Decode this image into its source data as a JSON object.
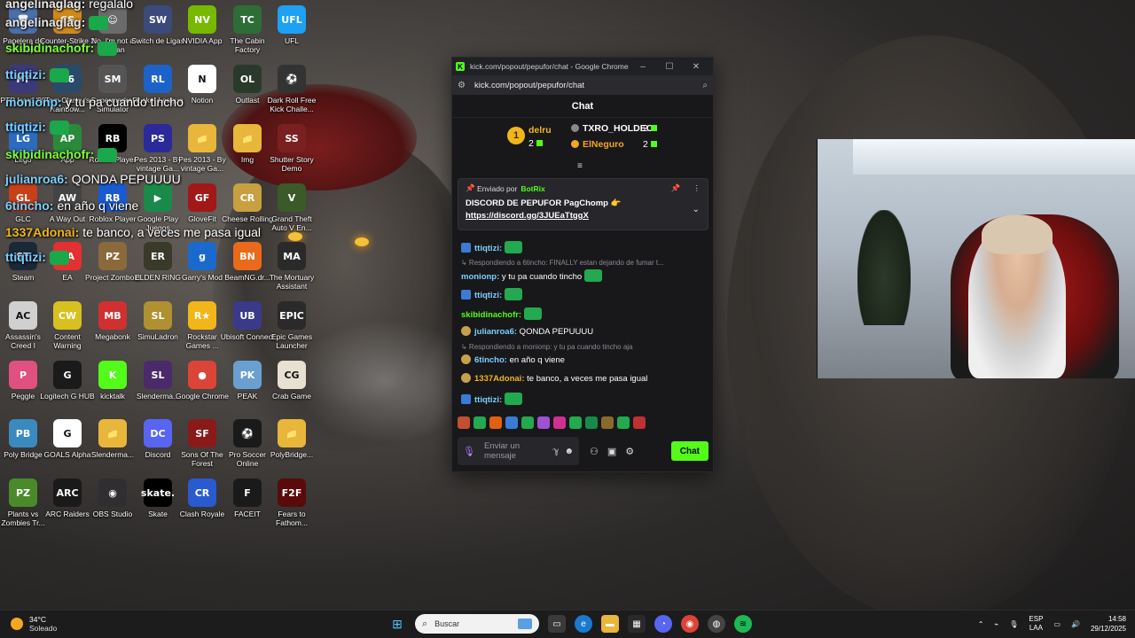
{
  "desktop": {
    "icons": [
      {
        "label": "Papelera de reciclaje",
        "glyph": "🗑",
        "color": "#4b6fa8"
      },
      {
        "label": "Counter-Strike 2",
        "glyph": "CS",
        "color": "#d08a1c"
      },
      {
        "label": "No, I'm not a Human",
        "glyph": "☺",
        "color": "#6b6b6b"
      },
      {
        "label": "Switch de Ligas",
        "glyph": "SW",
        "color": "#3b4a7a"
      },
      {
        "label": "NVIDIA App",
        "glyph": "NV",
        "color": "#76b900"
      },
      {
        "label": "The Cabin Factory",
        "glyph": "TC",
        "color": "#2f6d36"
      },
      {
        "label": "UFL",
        "glyph": "UFL",
        "color": "#1da1f2"
      },
      {
        "label": "PTP Icaro '90",
        "glyph": "PT",
        "color": "#3a3a7a"
      },
      {
        "label": "Tom Clancy's Rainbow...",
        "glyph": "R6",
        "color": "#2a4a6a"
      },
      {
        "label": "Supermarket Simulator",
        "glyph": "SM",
        "color": "#555"
      },
      {
        "label": "Rocket League",
        "glyph": "RL",
        "color": "#1d62c9"
      },
      {
        "label": "Notion",
        "glyph": "N",
        "color": "#fff"
      },
      {
        "label": "Outlast",
        "glyph": "OL",
        "color": "#2a3a2a"
      },
      {
        "label": "Dark Roll Free Kick Challe...",
        "glyph": "⚽",
        "color": "#333"
      },
      {
        "label": "Lego",
        "glyph": "LG",
        "color": "#2b6cbf"
      },
      {
        "label": "App",
        "glyph": "AP",
        "color": "#2a8a3a"
      },
      {
        "label": "Roblox Player",
        "glyph": "RB",
        "color": "#000"
      },
      {
        "label": "Pes 2013 - By vintage Ga...",
        "glyph": "PS",
        "color": "#2a2a9a"
      },
      {
        "label": "Pes 2013 - By vintage Ga...",
        "glyph": "📁",
        "color": "#e8b63a"
      },
      {
        "label": "Img",
        "glyph": "📁",
        "color": "#e8b63a"
      },
      {
        "label": "Shutter Story Demo",
        "glyph": "SS",
        "color": "#7a2020"
      },
      {
        "label": "GLC",
        "glyph": "GL",
        "color": "#c8401a"
      },
      {
        "label": "A Way Out",
        "glyph": "AW",
        "color": "#444"
      },
      {
        "label": "Roblox Player",
        "glyph": "RB",
        "color": "#1a5ad0"
      },
      {
        "label": "Google Play Juegos",
        "glyph": "▶",
        "color": "#1a8a4a"
      },
      {
        "label": "GloveFit",
        "glyph": "GF",
        "color": "#a01818"
      },
      {
        "label": "Cheese Rolling",
        "glyph": "CR",
        "color": "#c8a040"
      },
      {
        "label": "Grand Theft Auto V En...",
        "glyph": "V",
        "color": "#3a5a2a"
      },
      {
        "label": "Steam",
        "glyph": "ST",
        "color": "#1b2838"
      },
      {
        "label": "EA",
        "glyph": "EA",
        "color": "#e43030"
      },
      {
        "label": "Project Zomboid",
        "glyph": "PZ",
        "color": "#8a6a3a"
      },
      {
        "label": "ELDEN RING",
        "glyph": "ER",
        "color": "#3a3a2a"
      },
      {
        "label": "Garry's Mod",
        "glyph": "g",
        "color": "#1a6acd"
      },
      {
        "label": "BeamNG.dr...",
        "glyph": "BN",
        "color": "#e86a1a"
      },
      {
        "label": "The Mortuary Assistant",
        "glyph": "MA",
        "color": "#2a2a2a"
      },
      {
        "label": "Assassin's Creed I",
        "glyph": "AC",
        "color": "#d0d0d0"
      },
      {
        "label": "Content Warning",
        "glyph": "CW",
        "color": "#d8c020"
      },
      {
        "label": "Megabonk",
        "glyph": "MB",
        "color": "#d03030"
      },
      {
        "label": "SimuLadron",
        "glyph": "SL",
        "color": "#b09030"
      },
      {
        "label": "Rockstar Games ...",
        "glyph": "R★",
        "color": "#f2b61a"
      },
      {
        "label": "Ubisoft Connect",
        "glyph": "UB",
        "color": "#3a3a8a"
      },
      {
        "label": "Epic Games Launcher",
        "glyph": "EPIC",
        "color": "#2a2a2a"
      },
      {
        "label": "Peggle",
        "glyph": "P",
        "color": "#e05080"
      },
      {
        "label": "Logitech G HUB",
        "glyph": "G",
        "color": "#1a1a1a"
      },
      {
        "label": "kicktalk",
        "glyph": "K",
        "color": "#53fc18"
      },
      {
        "label": "Slenderma...",
        "glyph": "SL",
        "color": "#4a2a6a"
      },
      {
        "label": "Google Chrome",
        "glyph": "●",
        "color": "#db4437"
      },
      {
        "label": "PEAK",
        "glyph": "PK",
        "color": "#6aa0d0"
      },
      {
        "label": "Crab Game",
        "glyph": "CG",
        "color": "#e8e0d0"
      },
      {
        "label": "Poly Bridge",
        "glyph": "PB",
        "color": "#3a8ac0"
      },
      {
        "label": "GOALS Alpha",
        "glyph": "G",
        "color": "#fff"
      },
      {
        "label": "Slenderma...",
        "glyph": "📁",
        "color": "#e8b63a"
      },
      {
        "label": "Discord",
        "glyph": "DC",
        "color": "#5865f2"
      },
      {
        "label": "Sons Of The Forest",
        "glyph": "SF",
        "color": "#8a1a1a"
      },
      {
        "label": "Pro Soccer Online",
        "glyph": "⚽",
        "color": "#1a1a1a"
      },
      {
        "label": "PolyBridge...",
        "glyph": "📁",
        "color": "#e8b63a"
      },
      {
        "label": "Plants vs Zombies Tr...",
        "glyph": "PZ",
        "color": "#4a8a2a"
      },
      {
        "label": "ARC Raiders",
        "glyph": "ARC",
        "color": "#1a1a1a"
      },
      {
        "label": "OBS Studio",
        "glyph": "◉",
        "color": "#302e31"
      },
      {
        "label": "Skate",
        "glyph": "skate.",
        "color": "#000"
      },
      {
        "label": "Clash Royale",
        "glyph": "CR",
        "color": "#2a5ad0"
      },
      {
        "label": "FACEIT",
        "glyph": "F",
        "color": "#1a1a1a"
      },
      {
        "label": "Fears to Fathom...",
        "glyph": "F2F",
        "color": "#5a0a0a"
      }
    ]
  },
  "overlay": [
    {
      "user": "angelinaglag:",
      "msg": "regalalo",
      "color": "#e8e8e8"
    },
    {
      "user": "angelinaglag:",
      "msg": "",
      "color": "#e8e8e8"
    },
    {
      "user": "skibidinachofr:",
      "msg": "",
      "color": "#7cff3a"
    },
    {
      "user": "ttiqtizi:",
      "msg": "",
      "color": "#7ad0ff"
    },
    {
      "user": "monionp:",
      "msg": "y tu pa cuando tincho",
      "color": "#7ad0ff"
    },
    {
      "user": "ttiqtizi:",
      "msg": "",
      "color": "#7ad0ff"
    },
    {
      "user": "skibidinachofr:",
      "msg": "",
      "color": "#7cff3a"
    },
    {
      "user": "julianroa6:",
      "msg": "QONDA PEPUUUU",
      "color": "#7ad0ff"
    },
    {
      "user": "6tincho:",
      "msg": "en año q viene",
      "color": "#7ad0ff"
    },
    {
      "user": "1337Adonai:",
      "msg": "te banco, a veces me pasa igual",
      "color": "#f2b61a"
    },
    {
      "user": "ttiqtizi:",
      "msg": "",
      "color": "#7ad0ff"
    }
  ],
  "browser": {
    "title": "kick.com/popout/pepufor/chat - Google Chrome",
    "minimize": "–",
    "maximize": "☐",
    "close": "✕",
    "url": "kick.com/popout/pepufor/chat"
  },
  "chat": {
    "header": "Chat",
    "leaderboard": {
      "first": {
        "rank": "1",
        "name": "delru",
        "count": "2"
      },
      "second": {
        "name": "TXRO_HOLDEO",
        "count": "2"
      },
      "third": {
        "name": "ElNeguro",
        "count": "2"
      }
    },
    "pinned": {
      "sent_by": "Enviado por",
      "bot": "BotRix",
      "message": "DISCORD DE PEPUFOR PagChomp 👉",
      "link": "https://discord.gg/3JUEaTtggX"
    },
    "messages": [
      {
        "type": "msg",
        "user": "ttiqtizi:",
        "text": "",
        "color": "#7ad0ff",
        "badge": "sq",
        "emote": true
      },
      {
        "type": "reply",
        "text": "Respondiendo a 6tincho: FINALLY estan dejando de fumar t..."
      },
      {
        "type": "msg",
        "user": "monionp:",
        "text": "y tu pa cuando tincho",
        "color": "#7ad0ff",
        "badge": "",
        "emote": true
      },
      {
        "type": "msg",
        "user": "ttiqtizi:",
        "text": "",
        "color": "#7ad0ff",
        "badge": "sq",
        "emote": true
      },
      {
        "type": "msg",
        "user": "skibidinachofr:",
        "text": "",
        "color": "#53fc18",
        "badge": "",
        "emote": true
      },
      {
        "type": "msg",
        "user": "julianroa6:",
        "text": "QONDA PEPUUUU",
        "color": "#7ad0ff",
        "badge": "rd",
        "emote": false
      },
      {
        "type": "reply",
        "text": "Respondiendo a monionp: y tu pa cuando tincho aja"
      },
      {
        "type": "msg",
        "user": "6tincho:",
        "text": "en año q viene",
        "color": "#7ad0ff",
        "badge": "rd",
        "emote": false
      },
      {
        "type": "msg",
        "user": "1337Adonai:",
        "text": "te banco, a veces me pasa igual",
        "color": "#f2b61a",
        "badge": "rd",
        "emote": false
      },
      {
        "type": "msg",
        "user": "ttiqtizi:",
        "text": "",
        "color": "#7ad0ff",
        "badge": "sq",
        "emote": true
      }
    ],
    "input_placeholder": "Enviar un mensaje",
    "send_label": "Chat"
  },
  "taskbar": {
    "temp": "34°C",
    "condition": "Soleado",
    "search_placeholder": "Buscar",
    "lang_top": "ESP",
    "lang_bottom": "LAA",
    "time": "14:58",
    "date": "29/12/2025"
  }
}
